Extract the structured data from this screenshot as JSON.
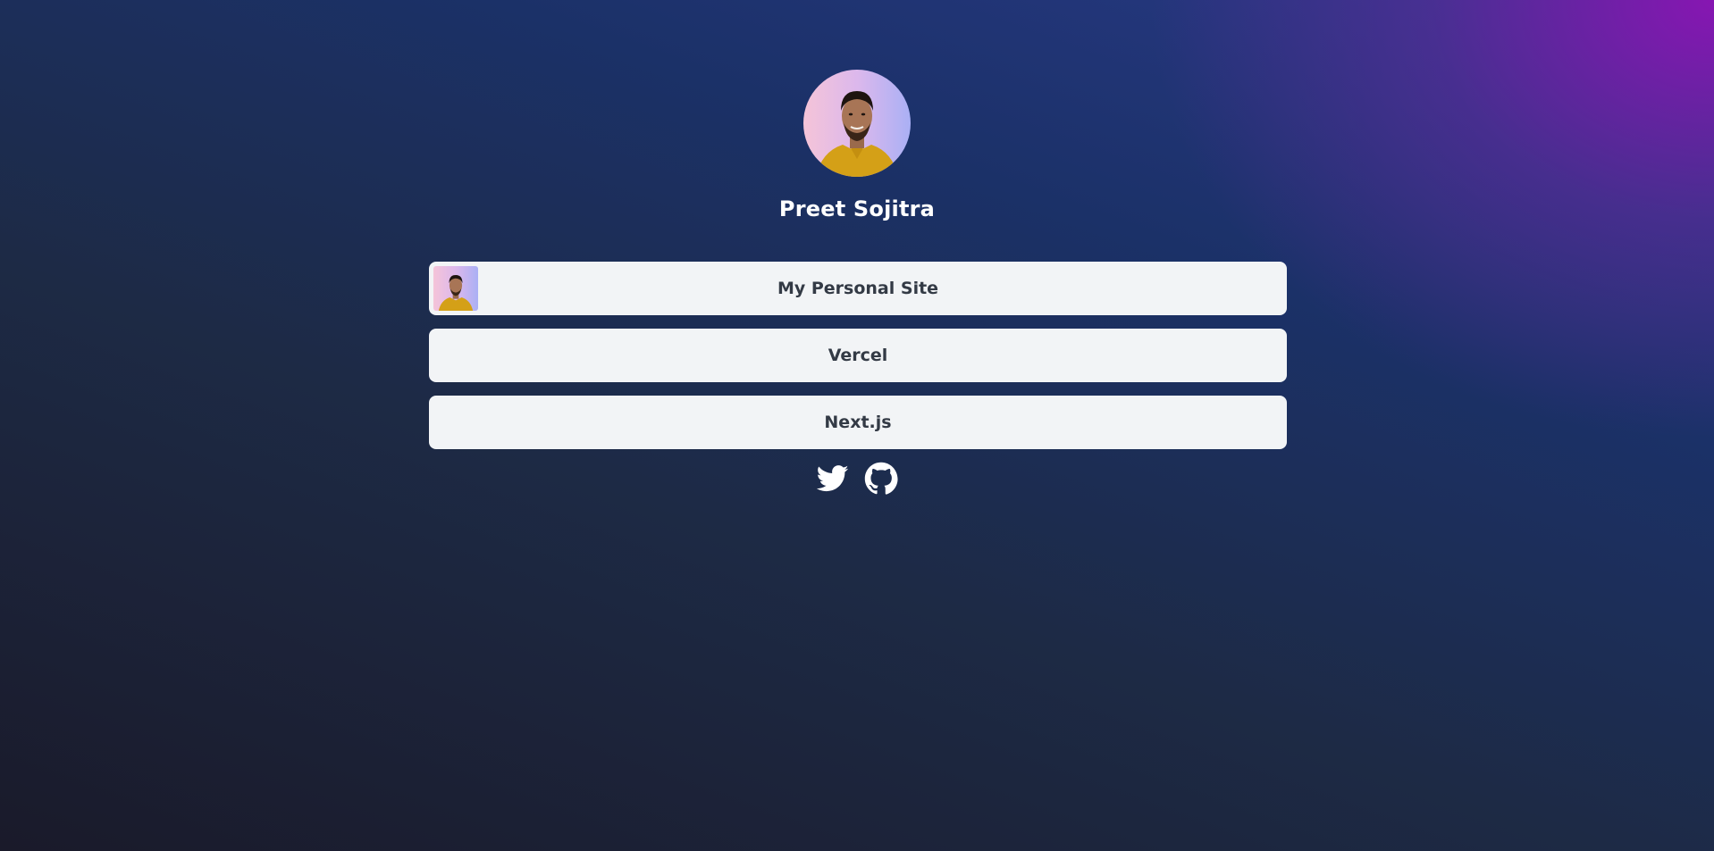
{
  "profile": {
    "name": "Preet Sojitra"
  },
  "links": [
    {
      "label": "My Personal Site",
      "has_thumbnail": true
    },
    {
      "label": "Vercel",
      "has_thumbnail": false
    },
    {
      "label": "Next.js",
      "has_thumbnail": false
    }
  ],
  "socials": [
    {
      "icon": "twitter-icon"
    },
    {
      "icon": "github-icon"
    }
  ],
  "colors": {
    "card_background": "#f2f4f6",
    "card_text": "#333a45",
    "name_text": "#ffffff",
    "gradient_accent": "#8a14b4"
  }
}
